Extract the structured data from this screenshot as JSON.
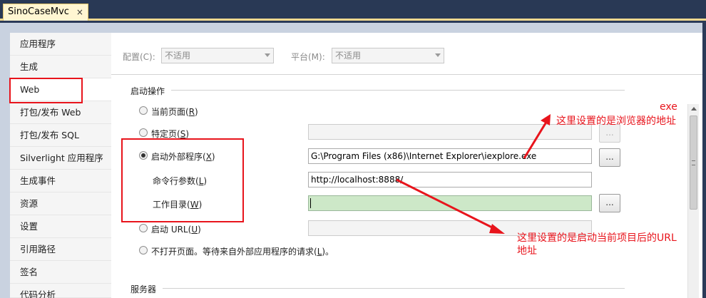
{
  "tab": {
    "title": "SinoCaseMvc",
    "close_glyph": "×"
  },
  "sidebar": {
    "items": [
      {
        "label": "应用程序"
      },
      {
        "label": "生成"
      },
      {
        "label": "Web"
      },
      {
        "label": "打包/发布 Web"
      },
      {
        "label": "打包/发布 SQL"
      },
      {
        "label": "Silverlight 应用程序"
      },
      {
        "label": "生成事件"
      },
      {
        "label": "资源"
      },
      {
        "label": "设置"
      },
      {
        "label": "引用路径"
      },
      {
        "label": "签名"
      },
      {
        "label": "代码分析"
      }
    ],
    "active_index": 2
  },
  "config": {
    "config_label": "配置(C):",
    "config_value": "不适用",
    "platform_label": "平台(M):",
    "platform_value": "不适用"
  },
  "start_action": {
    "section_title": "启动操作",
    "current_page": {
      "text": "当前页面(",
      "key": "R",
      "tail": ")"
    },
    "specific_page": {
      "text": "特定页(",
      "key": "S",
      "tail": ")",
      "value": "",
      "browse_label": "..."
    },
    "external_program": {
      "text": "启动外部程序(",
      "key": "X",
      "tail": ")",
      "value": "G:\\Program Files (x86)\\Internet Explorer\\iexplore.exe",
      "browse_label": "..."
    },
    "cmd_args": {
      "text": "命令行参数(",
      "key": "L",
      "tail": ")",
      "value": "http://localhost:8888/"
    },
    "working_dir": {
      "text": "工作目录(",
      "key": "W",
      "tail": ")",
      "value": "",
      "browse_label": "..."
    },
    "start_url": {
      "text": "启动 URL(",
      "key": "U",
      "tail": ")",
      "value": ""
    },
    "no_open": {
      "text": "不打开页面。等待来自外部应用程序的请求(",
      "key": "L",
      "tail": ")。"
    },
    "selected": "external_program"
  },
  "servers": {
    "section_title": "服务器"
  },
  "annotations": {
    "exe_label": "exe",
    "exe_note": "这里设置的是浏览器的地址",
    "url_note_line1": "这里设置的是启动当前项目后的URL",
    "url_note_line2": "地址",
    "color": "#e8141c"
  }
}
